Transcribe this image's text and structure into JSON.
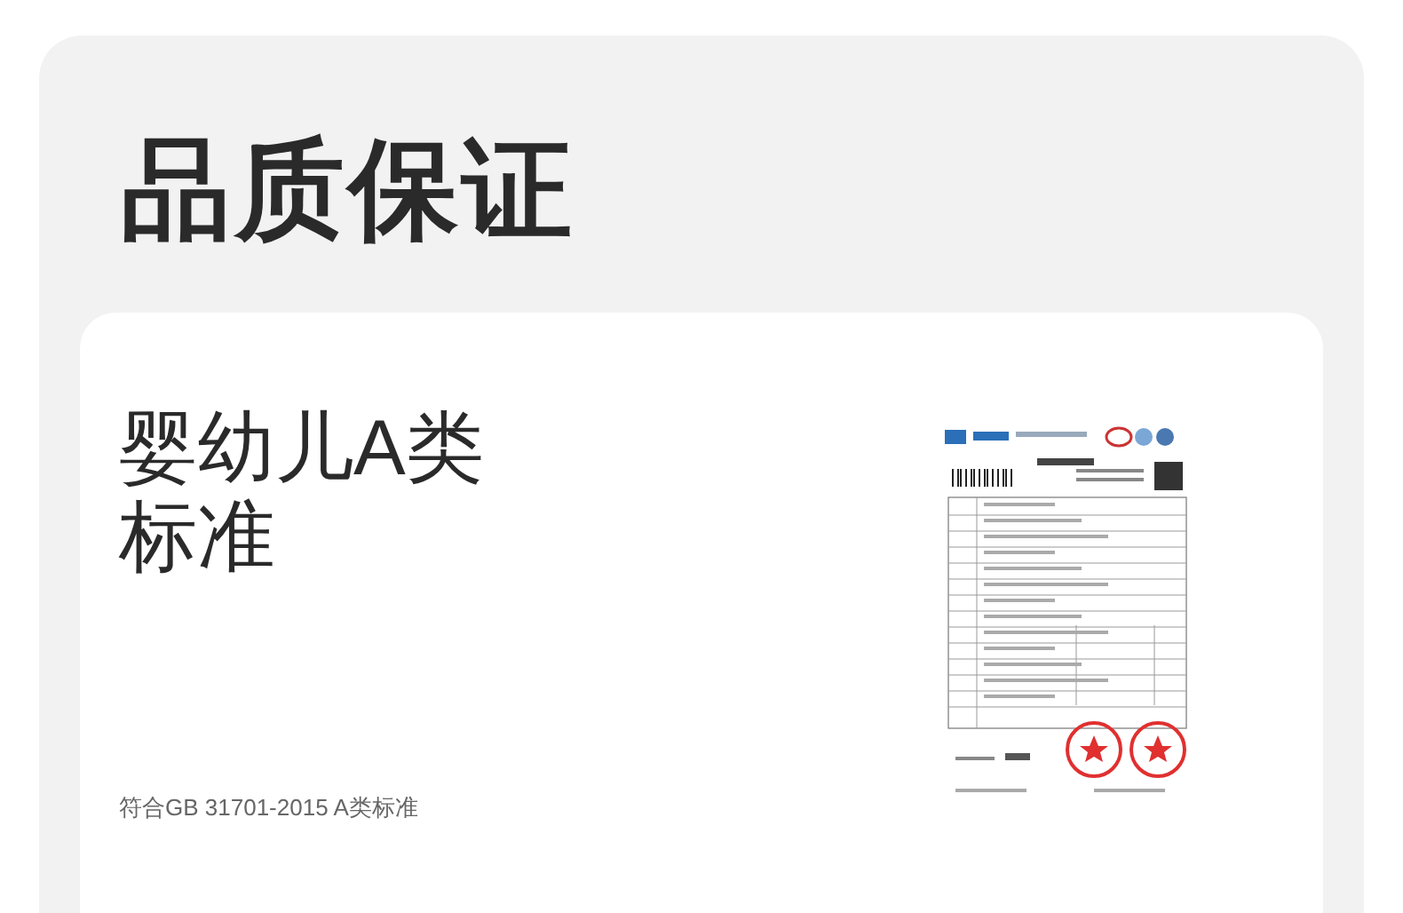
{
  "heading": "品质保证",
  "card": {
    "title_lines": [
      "婴幼儿A类",
      "标准"
    ],
    "note": "符合GB 31701-2015 A类标准"
  }
}
